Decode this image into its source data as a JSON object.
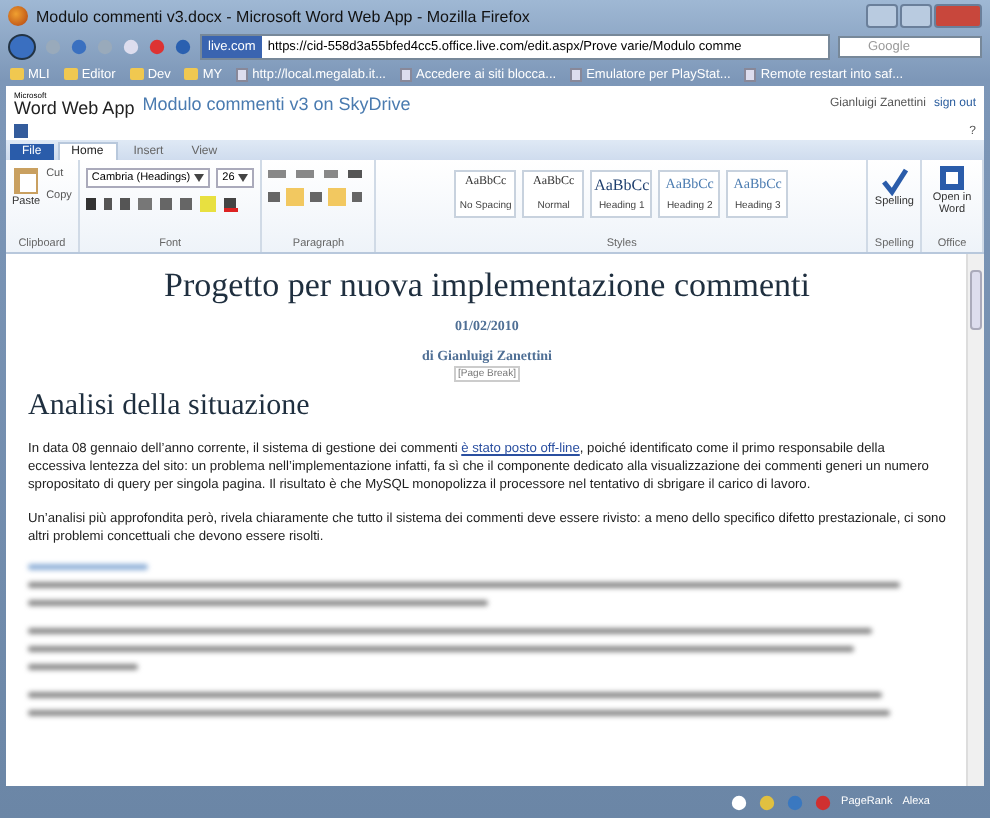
{
  "window": {
    "title": "Modulo commenti v3.docx - Microsoft Word Web App - Mozilla Firefox"
  },
  "browser": {
    "site": "live.com",
    "url": "https://cid-558d3a55bfed4cc5.office.live.com/edit.aspx/Prove varie/Modulo comme",
    "search_placeholder": "Google",
    "bookmarks": [
      {
        "label": "MLI",
        "kind": "folder"
      },
      {
        "label": "Editor",
        "kind": "folder"
      },
      {
        "label": "Dev",
        "kind": "folder"
      },
      {
        "label": "MY",
        "kind": "folder"
      },
      {
        "label": "http://local.megalab.it...",
        "kind": "page"
      },
      {
        "label": "Accedere ai siti blocca...",
        "kind": "page"
      },
      {
        "label": "Emulatore per PlayStat...",
        "kind": "page"
      },
      {
        "label": "Remote restart into saf...",
        "kind": "page"
      }
    ]
  },
  "app": {
    "brand_small": "Microsoft",
    "brand": "Word Web App",
    "doc_name": "Modulo commenti v3",
    "on": "on",
    "location": "SkyDrive",
    "user": "Gianluigi Zanettini",
    "sign_out": "sign out",
    "help": "?"
  },
  "ribbon": {
    "tabs": [
      {
        "label": "File",
        "selected": false,
        "kind": "file"
      },
      {
        "label": "Home",
        "selected": true,
        "kind": "tab"
      },
      {
        "label": "Insert",
        "selected": false,
        "kind": "tab"
      },
      {
        "label": "View",
        "selected": false,
        "kind": "tab"
      }
    ],
    "clipboard": {
      "paste": "Paste",
      "cut": "Cut",
      "copy": "Copy",
      "label": "Clipboard"
    },
    "font": {
      "name": "Cambria (Headings)",
      "size": "26",
      "label": "Font"
    },
    "paragraph": {
      "label": "Paragraph"
    },
    "styles": {
      "label": "Styles",
      "items": [
        {
          "preview": "AaBbCc",
          "name": "No Spacing",
          "kind": "plain"
        },
        {
          "preview": "AaBbCc",
          "name": "Normal",
          "kind": "plain"
        },
        {
          "preview": "AaBbCc",
          "name": "Heading 1",
          "kind": "heading1"
        },
        {
          "preview": "AaBbCc",
          "name": "Heading 2",
          "kind": "heading"
        },
        {
          "preview": "AaBbCc",
          "name": "Heading 3",
          "kind": "heading3"
        }
      ]
    },
    "spelling": {
      "button": "Spelling",
      "label": "Spelling"
    },
    "office": {
      "button": "Open in Word",
      "label": "Office"
    }
  },
  "document": {
    "title": "Progetto per nuova implementazione commenti",
    "date": "01/02/2010",
    "author": "di Gianluigi Zanettini",
    "page_break": "[Page Break]",
    "heading": "Analisi della situazione",
    "paragraphs": [
      {
        "before": "In data 08 gennaio dell’anno corrente, il sistema di gestione dei commenti ",
        "link": "è stato posto off-line",
        "after": ", poiché identificato come il primo responsabile della eccessiva lentezza del sito: un problema nell’implementazione infatti, fa sì che il componente dedicato alla visualizzazione dei commenti generi un numero spropositato di query per singola pagina. Il risultato è che MySQL monopolizza il processore nel tentativo di sbrigare il carico di lavoro."
      },
      {
        "before": "Un’analisi più approfondita però, rivela chiaramente che tutto il sistema dei commenti deve essere rivisto: a meno dello specifico difetto prestazionale, ci sono altri problemi concettuali che devono essere risolti."
      }
    ]
  },
  "status_bar": {
    "items": [
      "PageRank",
      "Alexa"
    ]
  }
}
